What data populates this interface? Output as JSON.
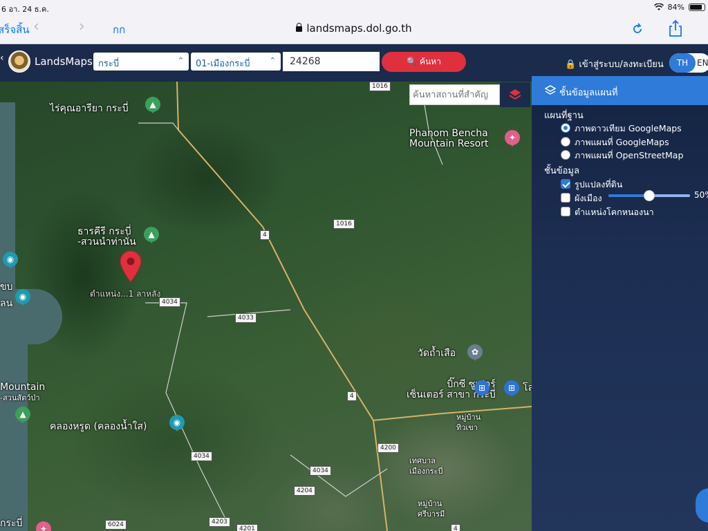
{
  "status_bar": {
    "time_date": "6  อา. 24 ธ.ค.",
    "battery": "84%"
  },
  "browser": {
    "done_label": "เสร็จสิ้น",
    "back_icon": "chevron-left-icon",
    "forward_icon": "chevron-right-icon",
    "text_size_label": "กก",
    "url": "landsmaps.dol.go.th",
    "reload_icon": "reload-icon",
    "share_icon": "share-icon"
  },
  "header": {
    "app_name": "LandsMaps",
    "province": "กระบี่",
    "district": "01-เมืองกระบี่",
    "parcel_no": "24268",
    "search_label": "ค้นหา",
    "login_label": "เข้าสู่ระบบ/ลงทะเบียน",
    "lang_th": "TH",
    "lang_en": "EN"
  },
  "map": {
    "place_search_placeholder": "ค้นหาสถานที่สำคัญ",
    "labels": {
      "farm": "ไร่คุณอารียา กระบี่",
      "park": "ธารคีรี กระบี่\n-สวนนำท่านั่น",
      "pin_label": "ตำแหน่ง...1 ลาหลัง",
      "resort": "Phanom Bencha\nMountain Resort",
      "temple": "วัดถ้ำเสือ",
      "bigc": "บิ๊กซี ซูเปอร์\nเซ็นเตอร์ สาขา กระบี่",
      "village": "หมู่บ้าน\nทิวเขา",
      "canal": "คลองหรูด (คลองน้ำใส)",
      "municipality": "เทศบาล\nเมืองกระบี่",
      "village2": "หมู่บ้าน\nศรีบารมี",
      "mountain": "Mountain",
      "mountain2": "-สวนสัตว์ป่า",
      "left_edge": "ขบ",
      "left_edge2": "ลน",
      "krabi": "กระบี่",
      "partial_right": "โล"
    },
    "routes": [
      "1016",
      "1016",
      "4",
      "4034",
      "4033",
      "4",
      "4200",
      "4034",
      "4034",
      "4204",
      "4203",
      "6024",
      "4201",
      "4"
    ]
  },
  "layers_panel": {
    "title": "ชั้นข้อมูลแผนที่",
    "base_map_heading": "แผนที่ฐาน",
    "base_maps": [
      {
        "label": "ภาพดาวเทียม GoogleMaps",
        "selected": true
      },
      {
        "label": "ภาพแผนที่ GoogleMaps",
        "selected": false
      },
      {
        "label": "ภาพแผนที่ OpenStreetMap",
        "selected": false
      }
    ],
    "data_heading": "ชั้นข้อมูล",
    "data_layers": [
      {
        "label": "รูปแปลงที่ดิน",
        "checked": true
      },
      {
        "label": "ผังเมือง",
        "checked": false
      },
      {
        "label": "ตำแหน่งโคกหนองนา",
        "checked": false
      }
    ],
    "opacity": "50%",
    "opacity_value": 0.5
  },
  "colors": {
    "header_bg": "#1a2b4b",
    "accent_blue": "#2f7bd9",
    "search_red": "#e0303e",
    "pin_red": "#e0303e"
  }
}
